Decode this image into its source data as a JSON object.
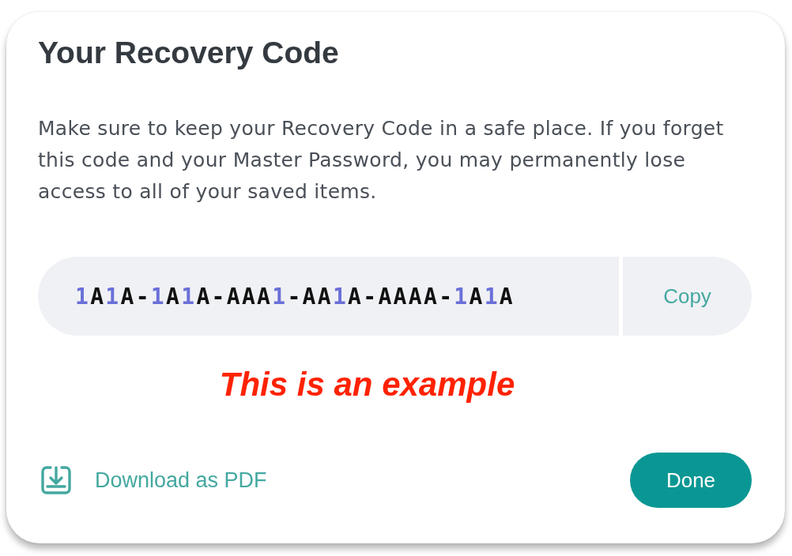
{
  "dialog": {
    "title": "Your Recovery Code",
    "message": "Make sure to keep your Recovery Code in a safe place. If you forget this code and your Master Password, you may permanently lose access to all of your saved items.",
    "recovery_code": {
      "value": "1A1A-1A1A-AAA1-AA1A-AAAA-1A1A",
      "copy_button": "Copy"
    },
    "annotation": "This is an example",
    "download_link": "Download as PDF",
    "done_button": "Done"
  }
}
